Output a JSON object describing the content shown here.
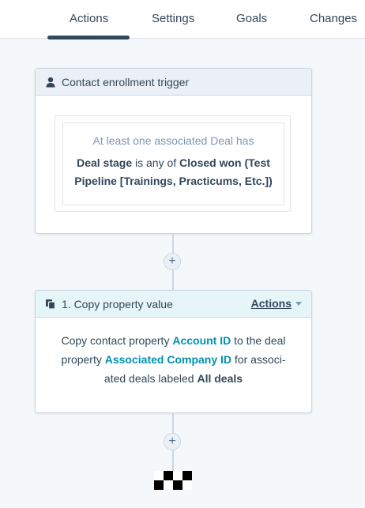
{
  "tabs": [
    {
      "label": "Actions",
      "active": true
    },
    {
      "label": "Settings"
    },
    {
      "label": "Goals"
    },
    {
      "label": "Changes"
    }
  ],
  "trigger": {
    "title": "Contact enrollment trigger",
    "filter_heading": "At least one associated Deal has",
    "filter_property": "Deal stage",
    "filter_operator": " is any of ",
    "filter_value": "Closed won (Test Pipeline [Trainings, Practicums, Etc.])"
  },
  "action": {
    "title": "1. Copy property value",
    "menu_label": "Actions",
    "text_1": "Copy contact property ",
    "source_property": "Account ID",
    "text_2": " to the deal property ",
    "target_property": "Associated Company ID",
    "text_3": " for associ-ated deals labeled ",
    "label_value": "All deals"
  },
  "add_button_symbol": "+",
  "colors": {
    "accent": "#0091ae",
    "text": "#33475b",
    "muted": "#7c98b6",
    "border": "#cbd6e2",
    "trigger_header": "#eaf0f6",
    "action_header": "#e5f5f8",
    "background": "#f5f8fa"
  },
  "icons": {
    "trigger": "contact-person-icon",
    "action": "copy-icon",
    "end": "checkered-flag-icon"
  }
}
